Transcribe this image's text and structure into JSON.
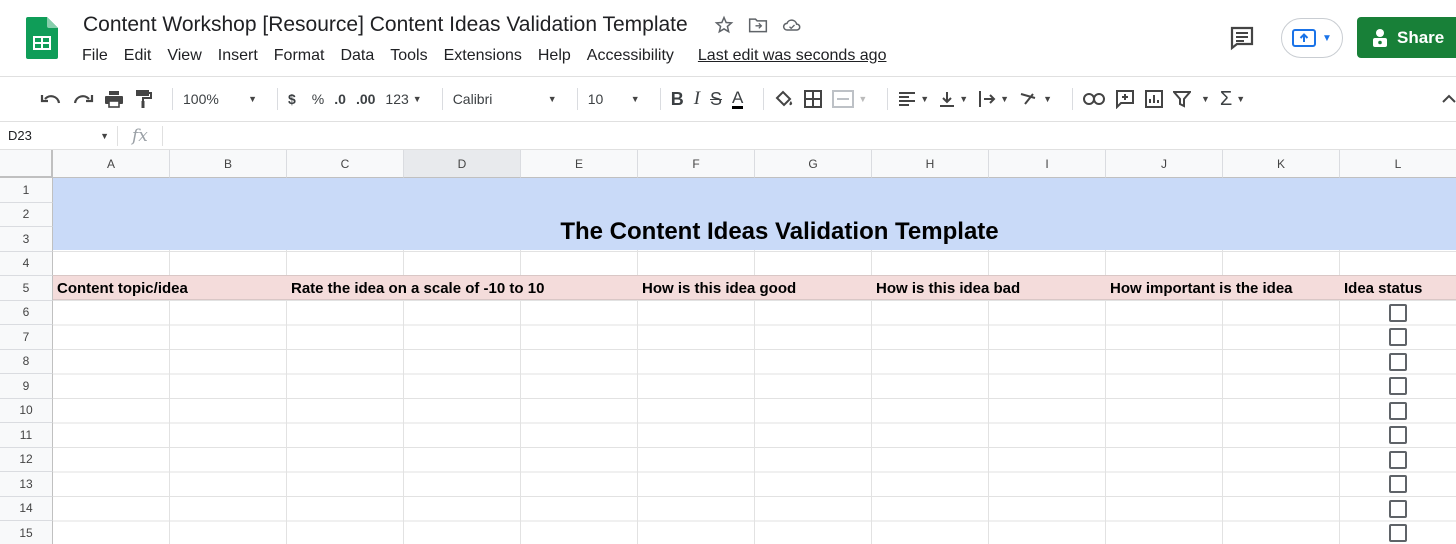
{
  "window": {
    "doc_title": "Content Workshop [Resource] Content Ideas Validation Template",
    "menu": [
      "File",
      "Edit",
      "View",
      "Insert",
      "Format",
      "Data",
      "Tools",
      "Extensions",
      "Help",
      "Accessibility"
    ],
    "last_edit": "Last edit was seconds ago",
    "share_label": "Share"
  },
  "toolbar": {
    "zoom": "100%",
    "currency": "$",
    "percent": "%",
    "dec_less": ".0",
    "dec_more": ".00",
    "format_123": "123",
    "font": "Calibri",
    "font_size": "10"
  },
  "formula_bar": {
    "cell_ref": "D23",
    "fx": "fx",
    "value": ""
  },
  "columns": [
    "A",
    "B",
    "C",
    "D",
    "E",
    "F",
    "G",
    "H",
    "I",
    "J",
    "K",
    "L"
  ],
  "selected_column": "D",
  "rows": [
    "1",
    "2",
    "3",
    "4",
    "5",
    "6",
    "7",
    "8",
    "9",
    "10",
    "11",
    "12",
    "13",
    "14",
    "15"
  ],
  "sheet": {
    "banner_title": "The Content Ideas Validation Template",
    "headers": [
      "Content topic/idea",
      "Rate the idea on a scale of -10 to 10",
      "How is this idea good",
      "How is this idea bad",
      "How important is the idea",
      "Idea status"
    ],
    "checkbox_rows": [
      "6",
      "7",
      "8",
      "9",
      "10",
      "11",
      "12",
      "13",
      "14",
      "15"
    ]
  },
  "colors": {
    "banner": "#c9daf8",
    "header_row": "#f4dcdb",
    "share": "#188038"
  }
}
